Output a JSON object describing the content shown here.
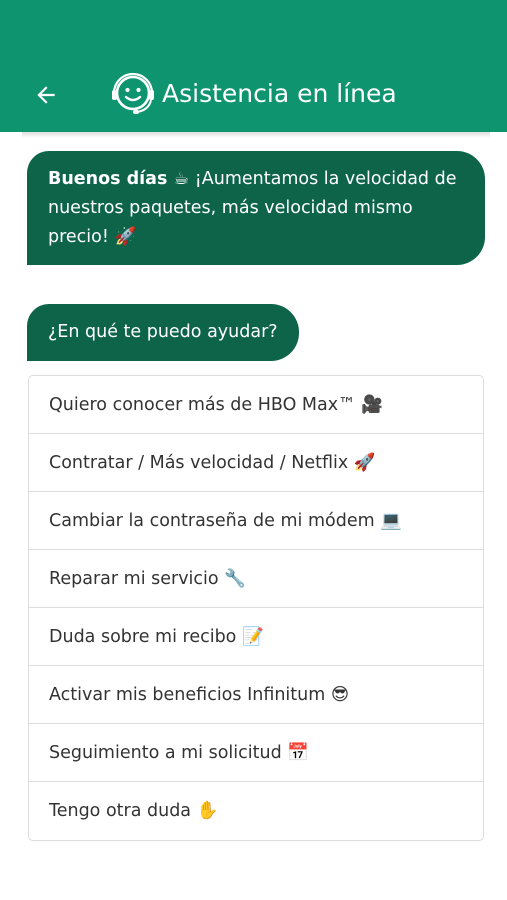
{
  "colors": {
    "header": "#0f9470",
    "bubble": "#0d6448",
    "option_text": "#333333",
    "border": "#dcdcdc"
  },
  "header": {
    "title": "Asistencia en línea",
    "back_icon": "arrow-left-icon",
    "bot_icon": "support-bot-icon"
  },
  "messages": {
    "greeting_bold": "Buenos días ☕",
    "greeting_text": " ¡Aumentamos la velocidad de nuestros paquetes, más velocidad mismo precio! 🚀",
    "question": "¿En qué te puedo ayudar?"
  },
  "options": [
    "Quiero conocer más de HBO Max™ 🎥",
    "Contratar / Más velocidad / Netflix 🚀",
    "Cambiar la contraseña de mi módem 💻",
    "Reparar mi servicio 🔧",
    "Duda sobre mi recibo 📝",
    "Activar mis beneficios Infinitum 😎",
    "Seguimiento a mi solicitud 📅",
    "Tengo otra duda ✋"
  ]
}
